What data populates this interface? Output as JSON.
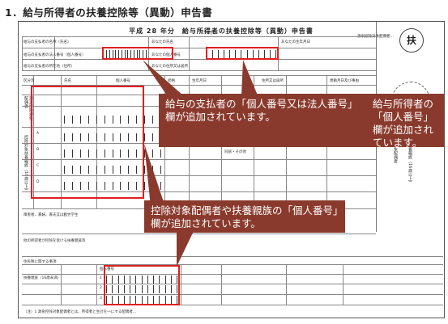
{
  "page": {
    "heading": "1．給与所得者の扶養控除等（異動）申告書"
  },
  "form": {
    "title": "平成 28 年分　給与所得者の扶養控除等（異動）申告書",
    "seal_char": "扶",
    "stamp_caption": "源泉控除対象配偶者…",
    "labels": {
      "payer_name": "給与の支払者の名称（氏名）",
      "payer_number": "給与の支払者の法人番号（個人番号）",
      "payer_address": "給与の支払者の所在地（住所）",
      "furigana": "（フリガナ）",
      "your_name": "あなたの氏名",
      "your_number": "あなたの個人番号",
      "birth": "あなたの生年月日",
      "address": "あなたの住所又は居所",
      "category": "区分等",
      "spouse_section": "源泉控除対象配偶者",
      "dependents_section": "控除対象扶養親族（16歳以上）",
      "disability_section": "障害者、寡婦、寡夫又は勤労学生",
      "other_payer": "他の所得者が控除を受ける扶養親族等",
      "resident_tax": "住民税に関する事項",
      "under16": "扶養親族（16歳未満）",
      "col_name": "氏名",
      "col_number": "個人番号",
      "col_relation": "続柄",
      "col_birth": "生年月日",
      "col_address": "住所又は居所",
      "col_change": "異動月日及び事由",
      "same_household": "同居・その他",
      "footnote": "（注）1 源泉控除対象配偶者とは、所得者と生計を一にする配偶者…"
    },
    "rows": [
      "A",
      "B",
      "C",
      "D"
    ],
    "dependent_rows": [
      "1",
      "2",
      "3"
    ]
  },
  "callouts": {
    "payer_number": "給与の支払者の「個人番号又は法人番号」欄が追加されています。",
    "earner_number": "給与所得者の「個人番号」欄が追加されています。",
    "family_number": "控除対象配偶者や扶養親族の「個人番号」欄が追加されています。"
  },
  "colors": {
    "highlight": "#e02020",
    "callout_bg": "#8a3a2c"
  }
}
